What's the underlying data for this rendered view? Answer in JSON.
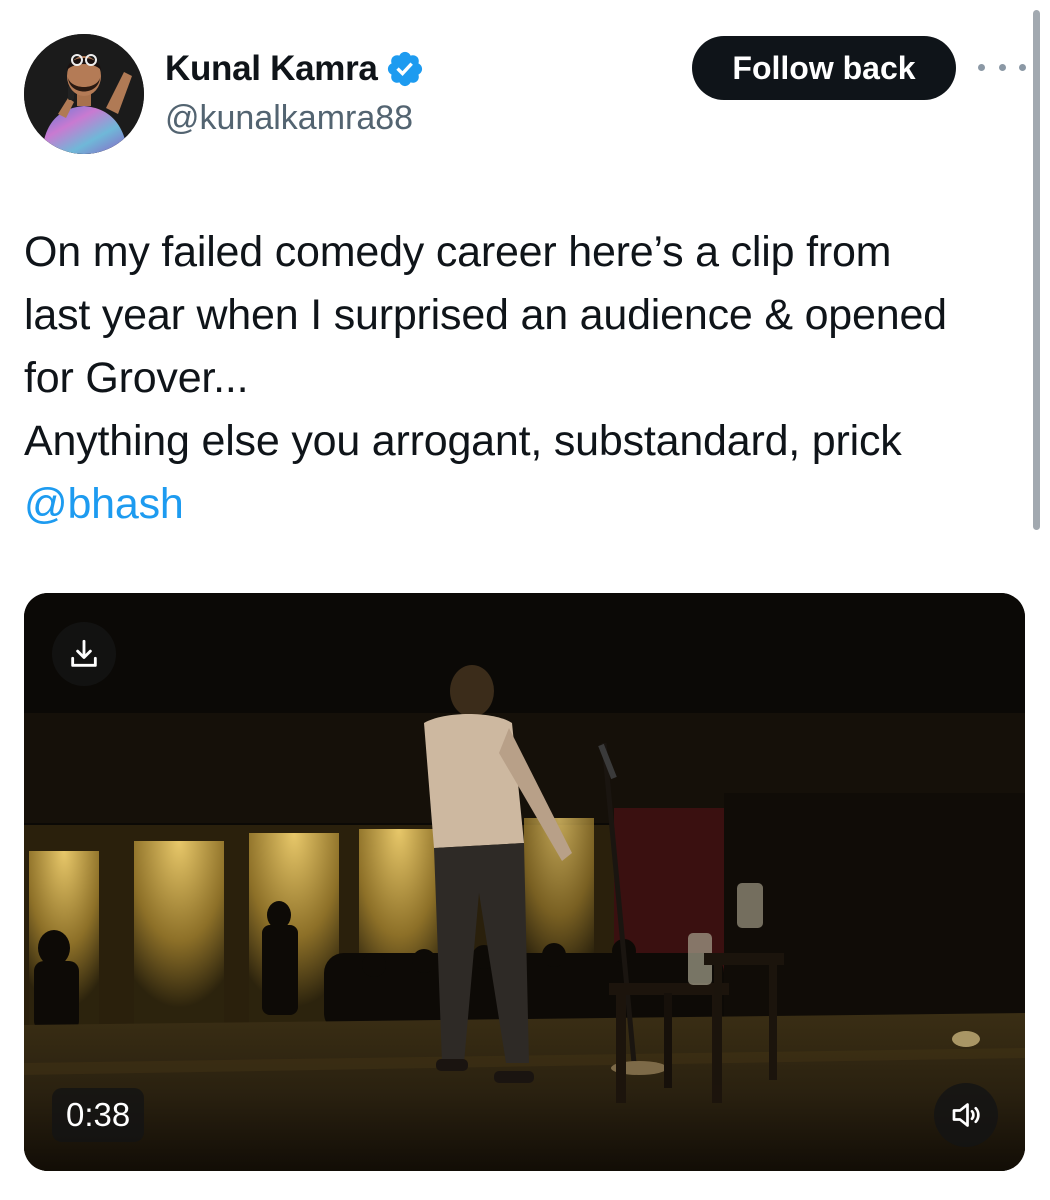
{
  "author": {
    "display_name": "Kunal Kamra",
    "handle": "@kunalkamra88",
    "verified": true,
    "verified_color": "#1d9bf0",
    "avatar_icon": "avatar-photo"
  },
  "header": {
    "follow_label": "Follow back",
    "more_icon": "more-horizontal-icon"
  },
  "tweet": {
    "lines": [
      "On my failed comedy career here’s a clip from",
      "last year when I surprised an audience & opened",
      "for Grover...",
      "Anything else you arrogant, substandard, prick"
    ],
    "mention": "@bhash",
    "mention_color": "#1d9bf0"
  },
  "media": {
    "type": "video",
    "duration": "0:38",
    "download_icon": "download-icon",
    "mute_icon": "speaker-muted-icon"
  },
  "colors": {
    "text": "#0f1419",
    "secondary": "#536471",
    "button_bg": "#0f1419",
    "button_text": "#ffffff"
  }
}
